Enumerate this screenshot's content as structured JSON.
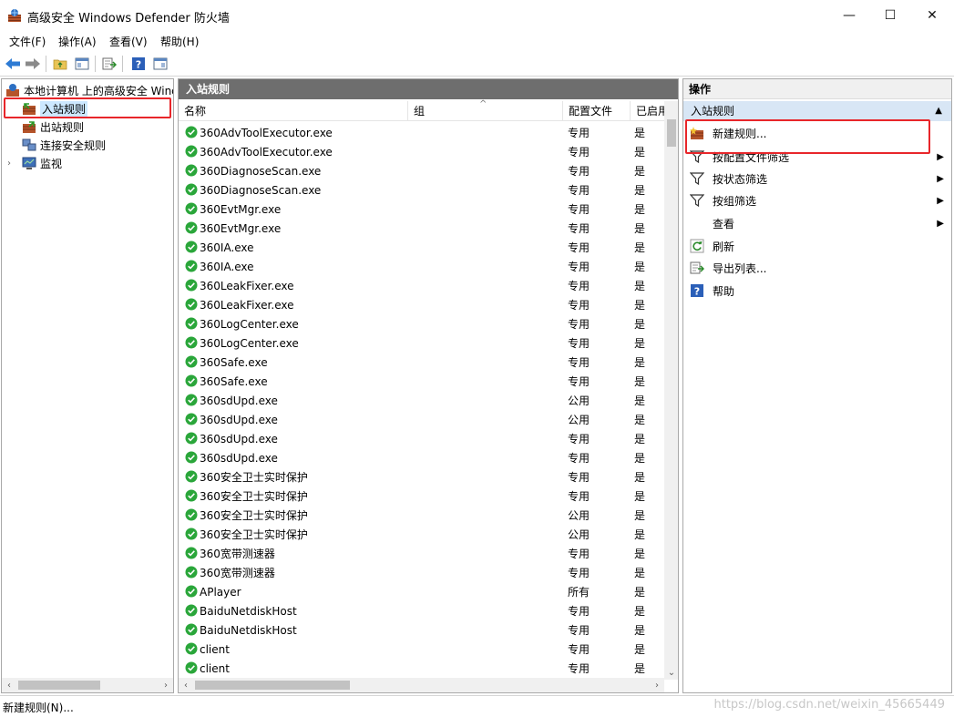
{
  "window": {
    "title": "高级安全 Windows Defender 防火墙",
    "minimize_glyph": "—",
    "maximize_glyph": "☐",
    "close_glyph": "✕"
  },
  "menu": [
    "文件(F)",
    "操作(A)",
    "查看(V)",
    "帮助(H)"
  ],
  "tree": {
    "root": "本地计算机 上的高级安全 Windows Defender 防火墙",
    "items": [
      "入站规则",
      "出站规则",
      "连接安全规则",
      "监视"
    ],
    "selected": "入站规则"
  },
  "center": {
    "header": "入站规则",
    "columns": {
      "name": "名称",
      "group": "组",
      "profile": "配置文件",
      "enabled": "已启用"
    },
    "rows": [
      {
        "name": "360AdvToolExecutor.exe",
        "profile": "专用",
        "enabled": "是"
      },
      {
        "name": "360AdvToolExecutor.exe",
        "profile": "专用",
        "enabled": "是"
      },
      {
        "name": "360DiagnoseScan.exe",
        "profile": "专用",
        "enabled": "是"
      },
      {
        "name": "360DiagnoseScan.exe",
        "profile": "专用",
        "enabled": "是"
      },
      {
        "name": "360EvtMgr.exe",
        "profile": "专用",
        "enabled": "是"
      },
      {
        "name": "360EvtMgr.exe",
        "profile": "专用",
        "enabled": "是"
      },
      {
        "name": "360IA.exe",
        "profile": "专用",
        "enabled": "是"
      },
      {
        "name": "360IA.exe",
        "profile": "专用",
        "enabled": "是"
      },
      {
        "name": "360LeakFixer.exe",
        "profile": "专用",
        "enabled": "是"
      },
      {
        "name": "360LeakFixer.exe",
        "profile": "专用",
        "enabled": "是"
      },
      {
        "name": "360LogCenter.exe",
        "profile": "专用",
        "enabled": "是"
      },
      {
        "name": "360LogCenter.exe",
        "profile": "专用",
        "enabled": "是"
      },
      {
        "name": "360Safe.exe",
        "profile": "专用",
        "enabled": "是"
      },
      {
        "name": "360Safe.exe",
        "profile": "专用",
        "enabled": "是"
      },
      {
        "name": "360sdUpd.exe",
        "profile": "公用",
        "enabled": "是"
      },
      {
        "name": "360sdUpd.exe",
        "profile": "公用",
        "enabled": "是"
      },
      {
        "name": "360sdUpd.exe",
        "profile": "专用",
        "enabled": "是"
      },
      {
        "name": "360sdUpd.exe",
        "profile": "专用",
        "enabled": "是"
      },
      {
        "name": "360安全卫士实时保护",
        "profile": "专用",
        "enabled": "是"
      },
      {
        "name": "360安全卫士实时保护",
        "profile": "专用",
        "enabled": "是"
      },
      {
        "name": "360安全卫士实时保护",
        "profile": "公用",
        "enabled": "是"
      },
      {
        "name": "360安全卫士实时保护",
        "profile": "公用",
        "enabled": "是"
      },
      {
        "name": "360宽带测速器",
        "profile": "专用",
        "enabled": "是"
      },
      {
        "name": "360宽带测速器",
        "profile": "专用",
        "enabled": "是"
      },
      {
        "name": "APlayer",
        "profile": "所有",
        "enabled": "是"
      },
      {
        "name": "BaiduNetdiskHost",
        "profile": "专用",
        "enabled": "是"
      },
      {
        "name": "BaiduNetdiskHost",
        "profile": "专用",
        "enabled": "是"
      },
      {
        "name": "client",
        "profile": "专用",
        "enabled": "是"
      },
      {
        "name": "client",
        "profile": "专用",
        "enabled": "是"
      }
    ]
  },
  "actions": {
    "header": "操作",
    "section": "入站规则",
    "items": [
      {
        "label": "新建规则...",
        "icon": "new-rule-icon",
        "submenu": false
      },
      {
        "label": "按配置文件筛选",
        "icon": "filter-icon",
        "submenu": true
      },
      {
        "label": "按状态筛选",
        "icon": "filter-icon",
        "submenu": true
      },
      {
        "label": "按组筛选",
        "icon": "filter-icon",
        "submenu": true
      },
      {
        "label": "查看",
        "icon": "",
        "submenu": true
      },
      {
        "label": "刷新",
        "icon": "refresh-icon",
        "submenu": false
      },
      {
        "label": "导出列表...",
        "icon": "export-icon",
        "submenu": false
      },
      {
        "label": "帮助",
        "icon": "help-icon",
        "submenu": false
      }
    ]
  },
  "status": {
    "text": "新建规则(N)...",
    "watermark": "https://blog.csdn.net/weixin_45665449"
  },
  "colors": {
    "highlight": "#e8262a",
    "pane_header": "#6e6e6e",
    "actions_sub": "#d8e6f5",
    "ok_green": "#2aa63a"
  }
}
